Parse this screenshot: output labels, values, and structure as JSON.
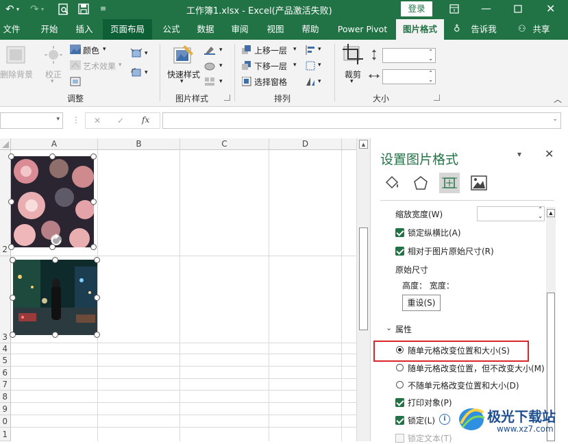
{
  "titlebar": {
    "doc_title": "工作簿1.xlsx  -  Excel(产品激活失败)",
    "login_label": "登录"
  },
  "tabs": [
    {
      "label": "文件"
    },
    {
      "label": "开始"
    },
    {
      "label": "插入"
    },
    {
      "label": "页面布局"
    },
    {
      "label": "公式"
    },
    {
      "label": "数据"
    },
    {
      "label": "审阅"
    },
    {
      "label": "视图"
    },
    {
      "label": "帮助"
    },
    {
      "label": "Power Pivot"
    },
    {
      "label": "图片格式"
    },
    {
      "label": "告诉我"
    },
    {
      "label": "共享"
    }
  ],
  "ribbon": {
    "remove_bg": "删除背景",
    "correct": "校正",
    "color": "颜色",
    "art_effects": "艺术效果",
    "quick_styles": "快速样式",
    "bring_forward": "上移一层",
    "send_backward": "下移一层",
    "selection_pane": "选择窗格",
    "crop": "裁剪",
    "groups": {
      "adjust": "调整",
      "picture_styles": "图片样式",
      "arrange": "排列",
      "size": "大小"
    }
  },
  "formula_bar": {
    "fx": "fx",
    "name_box": "",
    "formula": ""
  },
  "grid": {
    "columns": [
      "A",
      "B",
      "C",
      "D"
    ],
    "rows": [
      "2",
      "3",
      "4",
      "5",
      "6",
      "7",
      "8",
      "9",
      "0",
      "1"
    ]
  },
  "pane": {
    "title": "设置图片格式",
    "scale_width": "缩放宽度(W)",
    "lock_aspect": "锁定纵横比(A)",
    "relative_original": "相对于图片原始尺寸(R)",
    "original_size": "原始尺寸",
    "height_width": "高度：  宽度：",
    "reset": "重设(S)",
    "properties": "属性",
    "opt_move_size": "随单元格改变位置和大小(S)",
    "opt_move_only": "随单元格改变位置，但不改变大小(M)",
    "opt_none": "不随单元格改变位置和大小(D)",
    "print_object": "打印对象(P)",
    "locked": "锁定(L)",
    "lock_text": "锁定文本(T)",
    "highlight_color": "#d9252a"
  },
  "watermark": {
    "brand": "极光下载站",
    "url": "www.xz7.com"
  },
  "colors": {
    "excel_green": "#217346",
    "checkbox_green": "#217346"
  }
}
